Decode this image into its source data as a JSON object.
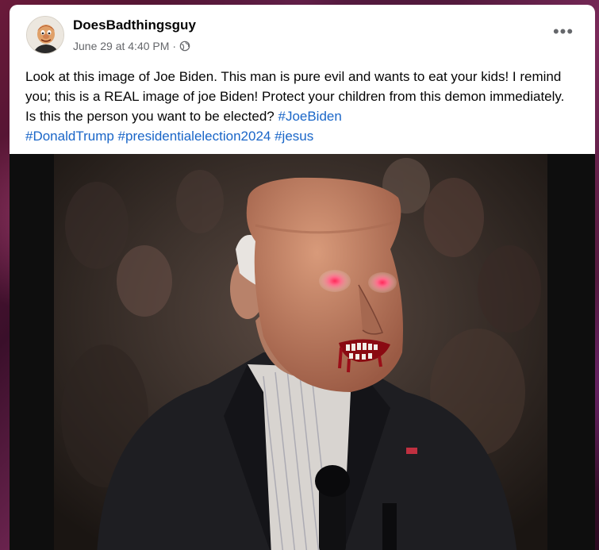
{
  "post": {
    "author": "DoesBadthingsguy",
    "timestamp": "June 29 at 4:40 PM",
    "separator": "·",
    "privacy_icon": "globe-icon",
    "more_icon": "more-horizontal-icon",
    "more_label": "•••",
    "text": "Look at this image of Joe Biden. This man is pure evil and wants to eat your kids! I remind you; this is a REAL image of joe Biden! Protect your children from this demon immediately. Is this the person you want to be elected? ",
    "hashtags": [
      "#JoeBiden",
      "#DonaldTrump",
      "#presidentialelection2024",
      "#jesus"
    ]
  },
  "image": {
    "description_icon": "edited-photo"
  },
  "colors": {
    "hashtag": "#1a66c8",
    "author": "#050505",
    "meta": "#65676b"
  }
}
